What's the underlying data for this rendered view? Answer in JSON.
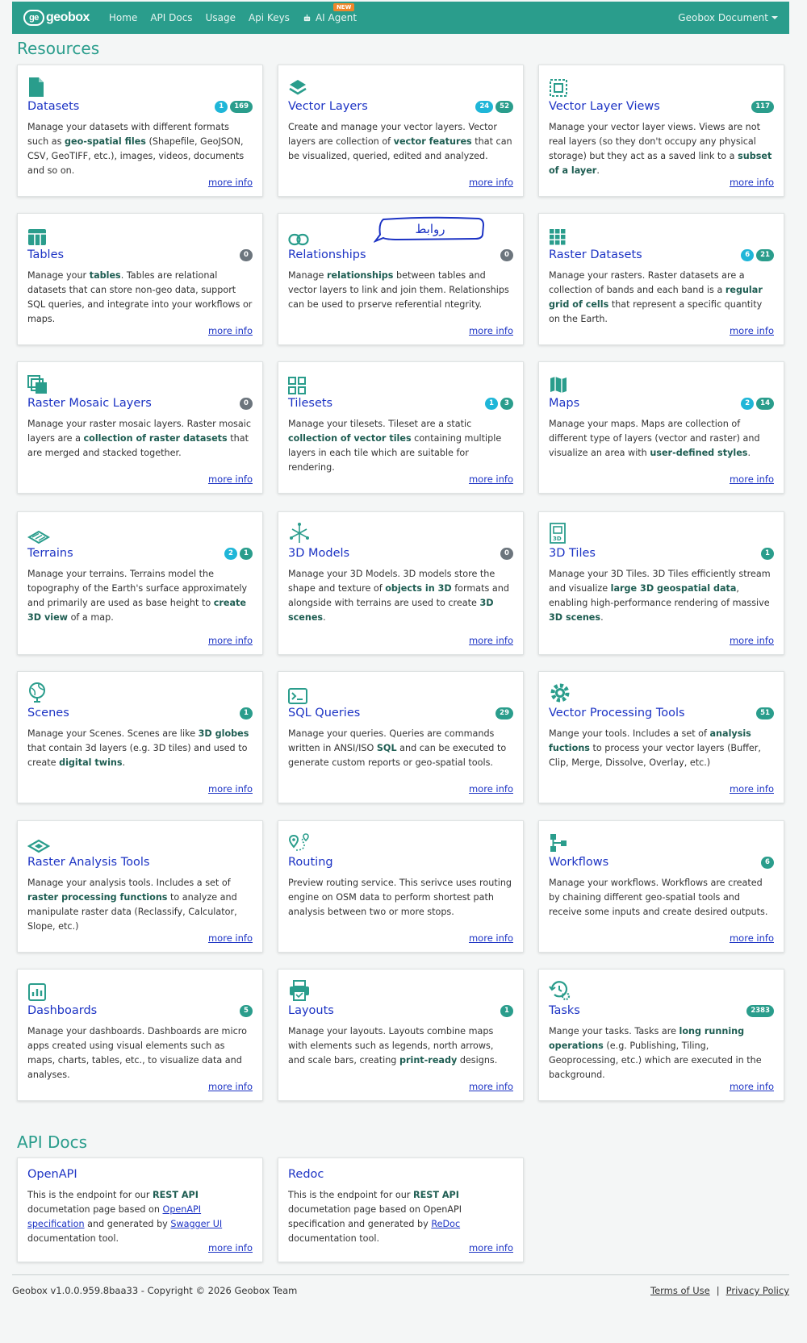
{
  "navbar": {
    "logo_text": "geobox",
    "items": [
      "Home",
      "API Docs",
      "Usage",
      "Api Keys"
    ],
    "ai_agent": "AI Agent",
    "new_badge": "NEW",
    "right_menu": "Geobox Document"
  },
  "resources": {
    "title": "Resources",
    "cards": [
      {
        "title": "Datasets",
        "icon": "file-icon",
        "badges": [
          {
            "v": "1",
            "c": "cyan"
          },
          {
            "v": "169",
            "c": "teal"
          }
        ],
        "more": "more info"
      },
      {
        "title": "Vector Layers",
        "icon": "layers-icon",
        "badges": [
          {
            "v": "24",
            "c": "cyan"
          },
          {
            "v": "52",
            "c": "teal"
          }
        ],
        "more": "more info"
      },
      {
        "title": "Vector Layer Views",
        "icon": "view-frame-icon",
        "badges": [
          {
            "v": "117",
            "c": "teal"
          }
        ],
        "more": "more info"
      },
      {
        "title": "Tables",
        "icon": "table-icon",
        "badges": [
          {
            "v": "0",
            "c": "gray"
          }
        ],
        "more": "more info"
      },
      {
        "title": "Relationships",
        "icon": "link-icon",
        "badges": [
          {
            "v": "0",
            "c": "gray"
          }
        ],
        "more": "more info"
      },
      {
        "title": "Raster Datasets",
        "icon": "grid-dots-icon",
        "badges": [
          {
            "v": "6",
            "c": "cyan"
          },
          {
            "v": "21",
            "c": "teal"
          }
        ],
        "more": "more info"
      },
      {
        "title": "Raster Mosaic Layers",
        "icon": "stacked-squares-icon",
        "badges": [
          {
            "v": "0",
            "c": "gray"
          }
        ],
        "more": "more info"
      },
      {
        "title": "Tilesets",
        "icon": "tiles-icon",
        "badges": [
          {
            "v": "1",
            "c": "cyan"
          },
          {
            "v": "3",
            "c": "teal"
          }
        ],
        "more": "more info"
      },
      {
        "title": "Maps",
        "icon": "map-icon",
        "badges": [
          {
            "v": "2",
            "c": "cyan"
          },
          {
            "v": "14",
            "c": "teal"
          }
        ],
        "more": "more info"
      },
      {
        "title": "Terrains",
        "icon": "terrain-icon",
        "badges": [
          {
            "v": "2",
            "c": "cyan"
          },
          {
            "v": "1",
            "c": "teal"
          }
        ],
        "more": "more info"
      },
      {
        "title": "3D Models",
        "icon": "3d-model-icon",
        "badges": [
          {
            "v": "0",
            "c": "gray"
          }
        ],
        "more": "more info"
      },
      {
        "title": "3D Tiles",
        "icon": "3d-tiles-icon",
        "badges": [
          {
            "v": "1",
            "c": "teal"
          }
        ],
        "more": "more info"
      },
      {
        "title": "Scenes",
        "icon": "globe-icon",
        "badges": [
          {
            "v": "1",
            "c": "teal"
          }
        ],
        "more": "more info"
      },
      {
        "title": "SQL Queries",
        "icon": "terminal-icon",
        "badges": [
          {
            "v": "29",
            "c": "teal"
          }
        ],
        "more": "more info"
      },
      {
        "title": "Vector Processing Tools",
        "icon": "gear-icon",
        "badges": [
          {
            "v": "51",
            "c": "teal"
          }
        ],
        "more": "more info"
      },
      {
        "title": "Raster Analysis Tools",
        "icon": "raster-layer-icon",
        "badges": [],
        "more": "more info"
      },
      {
        "title": "Routing",
        "icon": "route-icon",
        "badges": [],
        "more": "more info"
      },
      {
        "title": "Workflows",
        "icon": "workflow-icon",
        "badges": [
          {
            "v": "6",
            "c": "teal"
          }
        ],
        "more": "more info"
      },
      {
        "title": "Dashboards",
        "icon": "chart-icon",
        "badges": [
          {
            "v": "5",
            "c": "teal"
          }
        ],
        "more": "more info"
      },
      {
        "title": "Layouts",
        "icon": "printer-icon",
        "badges": [
          {
            "v": "1",
            "c": "teal"
          }
        ],
        "more": "more info"
      },
      {
        "title": "Tasks",
        "icon": "history-gear-icon",
        "badges": [
          {
            "v": "2383",
            "c": "teal"
          }
        ],
        "more": "more info"
      }
    ]
  },
  "annotation": {
    "text": "روابط"
  },
  "api_docs": {
    "title": "API Docs",
    "cards": [
      {
        "title": "OpenAPI",
        "more": "more info"
      },
      {
        "title": "Redoc",
        "more": "more info"
      }
    ]
  },
  "footer": {
    "copyright": "Geobox v1.0.0.959.8baa33 - Copyright © 2026 Geobox Team",
    "terms": "Terms of Use",
    "separator": "|",
    "privacy": "Privacy Policy"
  },
  "descriptions": {
    "d0": [
      "Manage your datasets with different formats such as ",
      "geo-spatial files",
      " (Shapefile, GeoJSON, CSV, GeoTIFF, etc.), images, videos, documents and so on."
    ],
    "d1": [
      "Create and manage your vector layers. Vector layers are collection of ",
      "vector features",
      " that can be visualized, queried, edited and analyzed."
    ],
    "d2": [
      "Manage your vector layer views. Views are not real layers (so they don't occupy any physical storage) but they act as a saved link to a ",
      "subset of a layer",
      "."
    ],
    "d3": [
      "Manage your ",
      "tables",
      ". Tables are relational datasets that can store non-geo data, support SQL queries, and integrate into your workflows or maps."
    ],
    "d4": [
      "Manage ",
      "relationships",
      " between tables and vector layers to link and join them. Relationships can be used to prserve referential  ntegrity."
    ],
    "d5": [
      "Manage your rasters. Raster datasets are a collection of bands and each band is a ",
      "regular grid of cells",
      " that represent a specific quantity on the Earth."
    ],
    "d6": [
      "Manage your raster mosaic layers. Raster mosaic layers are a ",
      "collection of raster datasets",
      " that are merged and stacked together."
    ],
    "d7": [
      "Manage your tilesets. Tileset are a static ",
      "collection of vector tiles",
      " containing multiple layers in each tile which are suitable for rendering."
    ],
    "d8": [
      "Manage your maps. Maps are collection of different type of layers (vector and raster) and visualize an area with ",
      "user-defined styles",
      "."
    ],
    "d9": [
      "Manage your terrains. Terrains model the topography of the Earth's surface approximately and primarily are used as base height to ",
      "create 3D view",
      " of a map."
    ],
    "d10": [
      "Manage your 3D Models. 3D models store the shape and texture of ",
      "objects in 3D",
      " formats and alongside with terrains are used to create ",
      "3D scenes",
      "."
    ],
    "d11": [
      "Manage your 3D Tiles. 3D Tiles efficiently stream and visualize ",
      "large 3D geospatial data",
      ", enabling high-performance rendering of massive ",
      "3D scenes",
      "."
    ],
    "d12": [
      "Manage your Scenes. Scenes are like ",
      "3D globes",
      " that contain 3d layers (e.g. 3D tiles) and used to create ",
      "digital twins",
      "."
    ],
    "d13": [
      "Manage your queries. Queries are commands written in ANSI/ISO ",
      "SQL",
      " and can be executed to generate custom reports or geo-spatial tools."
    ],
    "d14": [
      "Mange your tools. Includes a set of ",
      "analysis fuctions",
      " to process your vector layers (Buffer, Clip, Merge, Dissolve, Overlay, etc.)"
    ],
    "d15": [
      "Manage your analysis tools. Includes a set of ",
      "raster processing functions",
      " to analyze and manipulate raster data (Reclassify, Calculator, Slope, etc.)"
    ],
    "d16": [
      "Preview routing service. This serivce uses routing engine on OSM data to perform shortest path analysis between two or more stops."
    ],
    "d17": [
      "Manage your workflows. Workflows are created by chaining different geo-spatial tools and receive some inputs and create desired outputs."
    ],
    "d18": [
      "Manage your dashboards. Dashboards are micro apps created using visual elements such as maps, charts, tables, etc., to visualize data and analyses."
    ],
    "d19": [
      "Manage your layouts. Layouts combine maps with elements such as legends, north arrows, and scale bars, creating ",
      "print-ready",
      " designs."
    ],
    "d20": [
      "Mange your tasks. Tasks are ",
      "long running operations",
      " (e.g. Publishing, Tiling, Geoprocessing, etc.) which are executed in the background."
    ],
    "api0": [
      "This is the endpoint for our ",
      "REST API",
      " documetation page based on ",
      "OpenAPI specification",
      " and generated by ",
      "Swagger UI",
      " documentation tool."
    ],
    "api1": [
      "This is the endpoint for our ",
      "REST API",
      " documetation page based on OpenAPI specification and generated by ",
      "ReDoc",
      " documentation tool."
    ]
  }
}
